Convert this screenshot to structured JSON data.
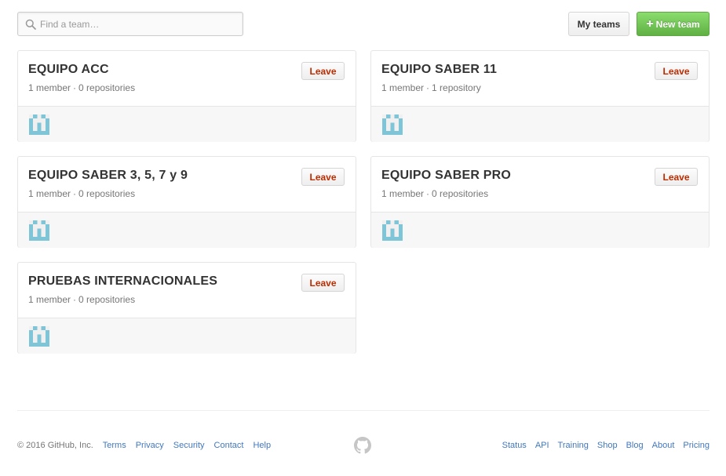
{
  "search": {
    "placeholder": "Find a team…"
  },
  "header": {
    "my_teams_label": "My teams",
    "new_team_label": "New team"
  },
  "teams": [
    {
      "name": "EQUIPO ACC",
      "members": "1 member",
      "repos": "0 repositories",
      "leave_label": "Leave"
    },
    {
      "name": "EQUIPO SABER 11",
      "members": "1 member",
      "repos": "1 repository",
      "leave_label": "Leave"
    },
    {
      "name": "EQUIPO SABER 3, 5, 7 y 9",
      "members": "1 member",
      "repos": "0 repositories",
      "leave_label": "Leave"
    },
    {
      "name": "EQUIPO SABER PRO",
      "members": "1 member",
      "repos": "0 repositories",
      "leave_label": "Leave"
    },
    {
      "name": "PRUEBAS INTERNACIONALES",
      "members": "1 member",
      "repos": "0 repositories",
      "leave_label": "Leave"
    }
  ],
  "meta_separator": "·",
  "footer": {
    "copyright": "© 2016 GitHub, Inc.",
    "left_links": [
      "Terms",
      "Privacy",
      "Security",
      "Contact",
      "Help"
    ],
    "right_links": [
      "Status",
      "API",
      "Training",
      "Shop",
      "Blog",
      "About",
      "Pricing"
    ]
  },
  "colors": {
    "accent_green": "#6cc644",
    "link_blue": "#4078c0",
    "leave_red": "#bd2c00",
    "avatar_teal": "#7ec5d8"
  },
  "icons": {
    "search": "search-icon",
    "plus": "plus-icon",
    "avatar": "identicon-avatar",
    "footer_mark": "github-octocat-icon"
  }
}
